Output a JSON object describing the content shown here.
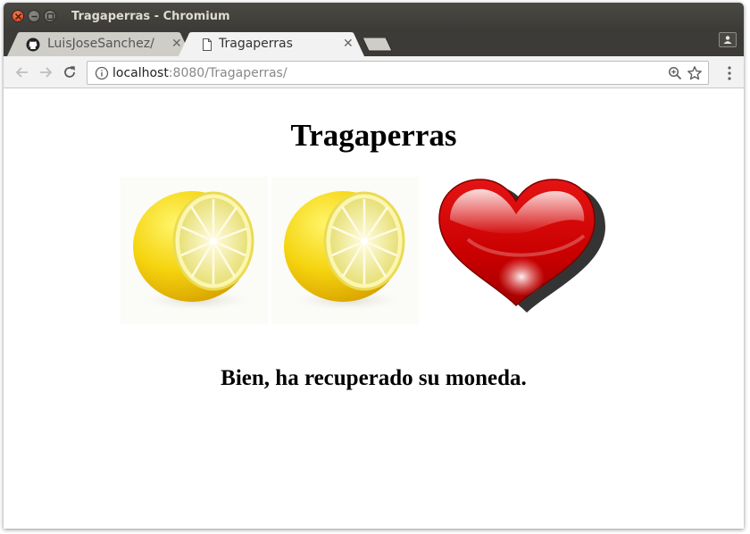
{
  "window": {
    "title": "Tragaperras - Chromium"
  },
  "tabs": [
    {
      "label": "LuisJoseSanchez/t",
      "icon": "github-icon",
      "active": false
    },
    {
      "label": "Tragaperras",
      "icon": "page-icon",
      "active": true
    }
  ],
  "toolbar": {
    "url_host": "localhost",
    "url_rest": ":8080/Tragaperras/"
  },
  "page": {
    "title": "Tragaperras",
    "reels": [
      {
        "symbol": "lemon"
      },
      {
        "symbol": "lemon"
      },
      {
        "symbol": "heart"
      }
    ],
    "message": "Bien, ha recuperado su moneda."
  },
  "colors": {
    "titlebar": "#3c3b37",
    "close_button": "#e1532b",
    "lemon": "#f5d30f",
    "heart": "#d40000"
  }
}
